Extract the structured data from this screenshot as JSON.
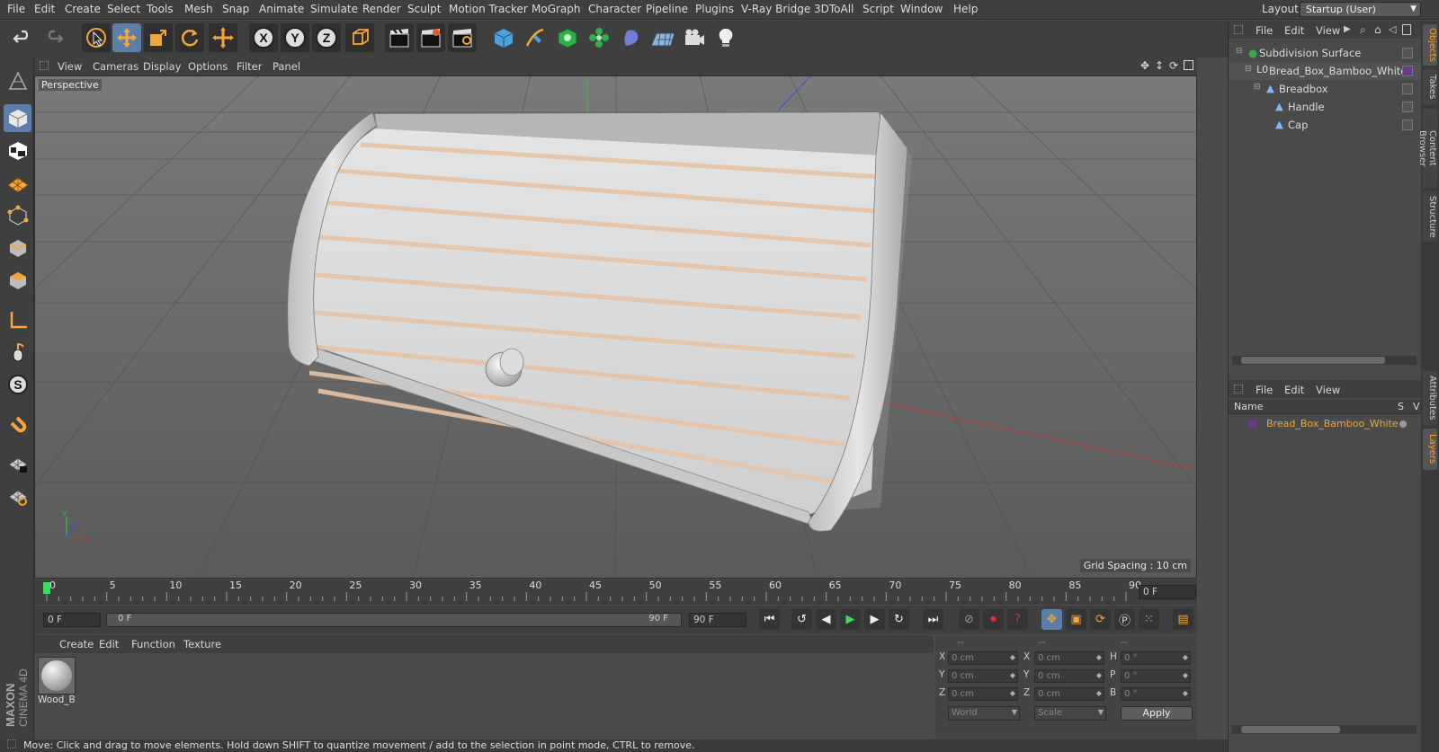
{
  "menubar": {
    "items": [
      "File",
      "Edit",
      "Create",
      "Select",
      "Tools",
      "Mesh",
      "Snap",
      "Animate",
      "Simulate",
      "Render",
      "Sculpt",
      "Motion Tracker",
      "MoGraph",
      "Character",
      "Pipeline",
      "Plugins",
      "V-Ray Bridge",
      "3DToAll",
      "Script",
      "Window",
      "Help"
    ],
    "layout_label": "Layout:",
    "layout_value": "Startup (User)"
  },
  "toolbar": {
    "icons": [
      "undo-icon",
      "redo-icon",
      "live-selection-icon",
      "move-icon",
      "scale-icon",
      "rotate-icon",
      "move-active-icon",
      "x-axis-icon",
      "y-axis-icon",
      "z-axis-icon",
      "world-coords-icon",
      "render-view-icon",
      "render-picture-viewer-icon",
      "render-settings-icon",
      "cube-icon",
      "pen-icon",
      "subdivision-icon",
      "cloner-icon",
      "deformer-icon",
      "floor-icon",
      "camera-icon",
      "light-icon"
    ],
    "axis_labels": [
      "X",
      "Y",
      "Z"
    ]
  },
  "left_tools": {
    "icons": [
      "make-editable-icon",
      "model-mode-icon",
      "texture-mode-icon",
      "workplane-icon",
      "points-mode-icon",
      "edges-mode-icon",
      "polygons-mode-icon",
      "axis-mode-icon",
      "tweak-icon",
      "snap-icon",
      "magnet-icon",
      "lock-workplane-icon",
      "grid-icon"
    ]
  },
  "viewport": {
    "menu": [
      "View",
      "Cameras",
      "Display",
      "Options",
      "Filter",
      "Panel"
    ],
    "label": "Perspective",
    "grid_spacing": "Grid Spacing : 10 cm",
    "axis_labels": [
      "Y",
      "Z",
      "X"
    ]
  },
  "timeline": {
    "ticks": [
      "0",
      "5",
      "10",
      "15",
      "20",
      "25",
      "30",
      "35",
      "40",
      "45",
      "50",
      "55",
      "60",
      "65",
      "70",
      "75",
      "80",
      "85",
      "90"
    ],
    "current_frame": "0 F"
  },
  "playbar": {
    "start": "0 F",
    "range_start": "0 F",
    "range_end": "90 F",
    "end": "90 F"
  },
  "material_manager": {
    "menu": [
      "Create",
      "Edit",
      "Function",
      "Texture"
    ],
    "materials": [
      {
        "name": "Wood_B"
      }
    ]
  },
  "coordinates": {
    "headers": [
      "--",
      "--",
      "--"
    ],
    "rows": [
      {
        "a_label": "X",
        "a_val": "0 cm",
        "b_label": "X",
        "b_val": "0 cm",
        "c_label": "H",
        "c_val": "0 °"
      },
      {
        "a_label": "Y",
        "a_val": "0 cm",
        "b_label": "Y",
        "b_val": "0 cm",
        "c_label": "P",
        "c_val": "0 °"
      },
      {
        "a_label": "Z",
        "a_val": "0 cm",
        "b_label": "Z",
        "b_val": "0 cm",
        "c_label": "B",
        "c_val": "0 °"
      }
    ],
    "world": "World",
    "scale": "Scale",
    "apply": "Apply"
  },
  "object_manager": {
    "menu": [
      "File",
      "Edit",
      "View"
    ],
    "objects": [
      {
        "name": "Subdivision Surface"
      },
      {
        "name": "Bread_Box_Bamboo_White"
      },
      {
        "name": "Breadbox"
      },
      {
        "name": "Handle"
      },
      {
        "name": "Cap"
      }
    ]
  },
  "layer_manager": {
    "menu": [
      "File",
      "Edit",
      "View"
    ],
    "col_name": "Name",
    "col_s": "S",
    "col_v": "V",
    "layers": [
      {
        "name": "Bread_Box_Bamboo_White",
        "color": "#6b3a87"
      }
    ]
  },
  "side_tabs": [
    "Objects",
    "Takes",
    "Content Browser",
    "Structure",
    "Attributes",
    "Layers"
  ],
  "status": "Move: Click and drag to move elements. Hold down SHIFT to quantize movement / add to the selection in point mode, CTRL to remove.",
  "brand": [
    "MAXON",
    "CINEMA 4D"
  ],
  "colors": {
    "accent": "#f4a53b",
    "active_tool": "#5b7fa8",
    "layer_color": "#6b3a87",
    "timeline_marker": "#3ddc5a"
  }
}
